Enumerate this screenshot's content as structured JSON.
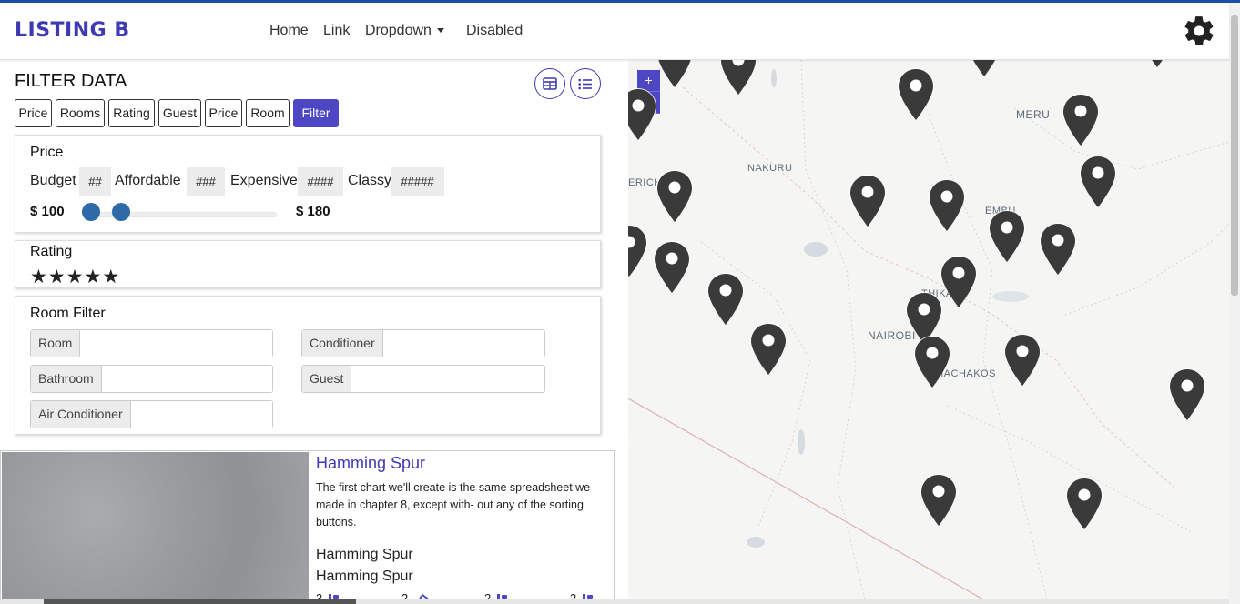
{
  "brand": "LISTING B",
  "nav": {
    "home": "Home",
    "link": "Link",
    "dropdown": "Dropdown",
    "disabled": "Disabled"
  },
  "filter": {
    "title": "FILTER DATA",
    "tabs": [
      "Price",
      "Rooms",
      "Rating",
      "Guest",
      "Price",
      "Room",
      "Filter"
    ],
    "active_tab": "Filter"
  },
  "price_card": {
    "title": "Price",
    "options": [
      {
        "label": "Budget",
        "code": "##"
      },
      {
        "label": "Affordable",
        "code": "###"
      },
      {
        "label": "Expensive",
        "code": "####"
      },
      {
        "label": "Classy",
        "code": "#####"
      }
    ],
    "min_label": "$ 100",
    "max_label": "$ 180"
  },
  "rating_card": {
    "title": "Rating",
    "stars": 5
  },
  "room_filter": {
    "title": "Room Filter",
    "fields": {
      "room": "Room",
      "conditioner": "Conditioner",
      "bathroom": "Bathroom",
      "guest": "Guest",
      "air_conditioner": "Air Conditioner"
    }
  },
  "listing": {
    "title": "Hamming Spur",
    "description": "The first chart we'll create is the same spreadsheet we made in chapter 8, except with- out any of the sorting buttons.",
    "line1": "Hamming Spur",
    "line2": "Hamming Spur",
    "stats": [
      "3",
      "2",
      "2",
      "2"
    ]
  },
  "map": {
    "labels": {
      "meru": "MERU",
      "nakuru": "NAKURU",
      "kericho": "ERICHO",
      "embu": "EMBU",
      "thika": "THIKA",
      "nairobi": "NAIROBI",
      "machakos": "MACHAKOS"
    },
    "zoom_in": "+",
    "zoom_out": "−",
    "marker_count": 25
  },
  "colors": {
    "accent": "#4d47c4",
    "brand": "#3f3ab4",
    "pin": "#3a3a3a",
    "slider": "#2f6aa8"
  }
}
